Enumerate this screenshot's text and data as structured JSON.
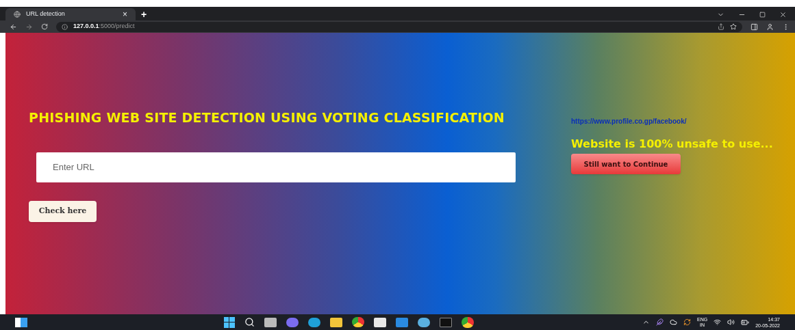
{
  "browser": {
    "tab_title": "URL detection",
    "tab_close": "×",
    "new_tab": "+",
    "url_host": "127.0.0.1",
    "url_path": ":5000/predict"
  },
  "page": {
    "heading": "PHISHING WEB SITE DETECTION USING VOTING CLASSIFICATION",
    "url_field": {
      "placeholder": "Enter URL"
    },
    "check_button": "Check here",
    "checked_url": "https://www.profile.co.gp/facebook/",
    "verdict": "Website is 100% unsafe to use...",
    "continue_button": "Still want to Continue"
  },
  "taskbar": {
    "language": "ENG",
    "region": "IN",
    "time": "14:37",
    "date": "20-05-2022"
  }
}
